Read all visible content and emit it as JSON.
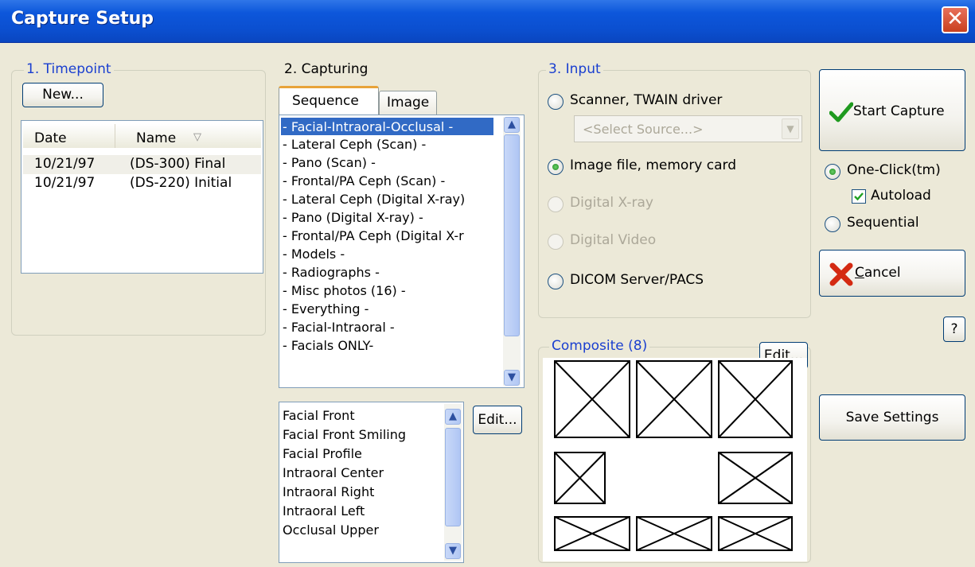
{
  "window": {
    "title": "Capture Setup",
    "close_glyph": "✕"
  },
  "timepoint": {
    "legend": "1. Timepoint",
    "new_button": "New...",
    "columns": [
      "Date",
      "Name"
    ],
    "sort_glyph": "▽",
    "rows": [
      {
        "date": "10/21/97",
        "name": "(DS-300) Final"
      },
      {
        "date": "10/21/97",
        "name": "(DS-220) Initial"
      }
    ]
  },
  "capturing": {
    "legend": "2. Capturing",
    "tabs": [
      "Sequence",
      "Image"
    ],
    "sequences": [
      "- Facial-Intraoral-Occlusal -",
      "- Lateral Ceph (Scan) -",
      "- Pano (Scan) -",
      "- Frontal/PA Ceph (Scan) -",
      "- Lateral Ceph (Digital X-ray)",
      "- Pano (Digital X-ray) -",
      "- Frontal/PA Ceph (Digital X-r",
      "- Models -",
      "- Radiographs -",
      "- Misc photos (16) -",
      "- Everything -",
      "- Facial-Intraoral -",
      "- Facials ONLY-"
    ],
    "images": [
      "Facial Front",
      "Facial Front Smiling",
      "Facial Profile",
      "Intraoral Center",
      "Intraoral Right",
      "Intraoral Left",
      "Occlusal Upper"
    ],
    "edit_button": "Edit..."
  },
  "input": {
    "legend": "3. Input",
    "scanner_label": "Scanner, TWAIN driver",
    "source_placeholder": "<Select Source...>",
    "image_file_label": "Image file, memory card",
    "digital_xray_label": "Digital X-ray",
    "digital_video_label": "Digital Video",
    "dicom_label": "DICOM Server/PACS",
    "selected": "Image file, memory card"
  },
  "composite": {
    "legend": "Composite (8)",
    "edit_button": "Edit..."
  },
  "actions": {
    "start_capture": "Start Capture",
    "one_click_label": "One-Click(tm)",
    "autoload_label": "Autoload",
    "autoload_checked": true,
    "sequential_label": "Sequential",
    "cancel_rest": "ancel",
    "cancel_mnemonic": "C",
    "help": "?",
    "save_settings": "Save Settings"
  },
  "colors": {
    "accent_blue": "#1a3fd0",
    "title_bar": "#0b4fd0",
    "selection": "#316ac5"
  }
}
